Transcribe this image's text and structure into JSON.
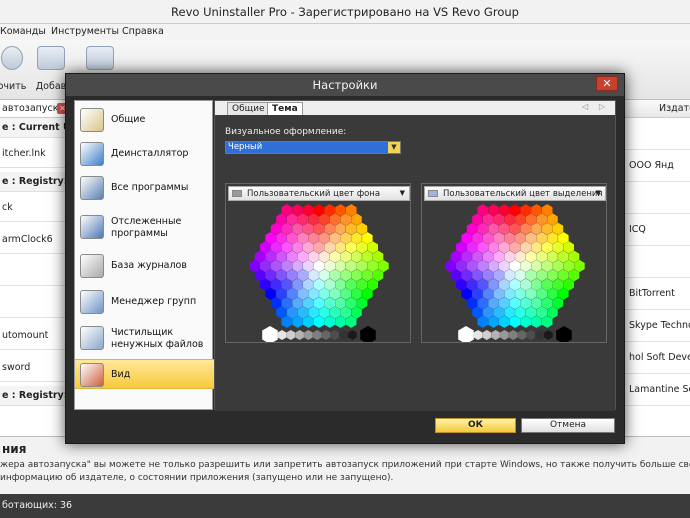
{
  "app": {
    "title": "Revo Uninstaller Pro - Зарегистрировано на VS Revo Group",
    "menu": [
      "Команды",
      "Инструменты",
      "Справка"
    ],
    "toolbar": [
      "очить",
      "Добав"
    ],
    "search_text": "автозапуска",
    "left_rows": [
      {
        "text": "e : Current User",
        "bold": true
      },
      {
        "text": "itcher.lnk",
        "bold": false
      },
      {
        "text": "e : Registry: HK",
        "bold": true
      },
      {
        "text": "ck",
        "bold": false
      },
      {
        "text": "armClock6",
        "bold": false
      },
      {
        "text": "",
        "bold": false
      },
      {
        "text": "",
        "bold": false
      },
      {
        "text": "utomount",
        "bold": false
      },
      {
        "text": "sword",
        "bold": false
      },
      {
        "text": "e : Registry: HK",
        "bold": true
      }
    ],
    "right_header": "Издате",
    "right_rows": [
      "",
      "ООО Янд",
      "",
      "ICQ",
      "",
      "BitTorrent",
      "Skype Technol",
      "hol Soft Develo",
      "Lamantine Sof",
      ""
    ],
    "info_title": "ния",
    "info_line1": "жера автозапуска\" вы можете не только разрешить или запретить автозапуск приложений при старте Windows, но также получить больше сведений о конкретном прило",
    "info_line2": "информацию об издателе, о состоянии приложения (запущено или не запущено).",
    "status": "ботающих: 36"
  },
  "dialog": {
    "title": "Настройки",
    "close_glyph": "✕",
    "nav": [
      {
        "label": "Общие",
        "icon": "clipboard-icon"
      },
      {
        "label": "Деинсталлятор",
        "icon": "uninstaller-icon"
      },
      {
        "label": "Все программы",
        "icon": "monitor-icon"
      },
      {
        "label": "Отслеженные программы",
        "icon": "user-monitor-icon"
      },
      {
        "label": "База журналов",
        "icon": "database-icon"
      },
      {
        "label": "Менеджер групп",
        "icon": "group-manager-icon"
      },
      {
        "label": "Чистильщик ненужных файлов",
        "icon": "cleaner-icon"
      },
      {
        "label": "Вид",
        "icon": "view-icon"
      }
    ],
    "active_nav": 7,
    "tabs": [
      "Общие",
      "Тема"
    ],
    "active_tab": 1,
    "tab_arrows": "◁ ▷",
    "visual_label": "Визуальное оформление:",
    "theme_value": "Черный",
    "picker_bg_label": "Пользовательский цвет фона",
    "picker_sel_label": "Пользовательский цвет выделения",
    "ok_label": "ОК",
    "cancel_label": "Отмена"
  },
  "colors": {
    "dialog_bg": "#2b2b2b",
    "content_bg": "#3a3a3a",
    "accent_yellow": "#f7c93c",
    "select_blue": "#2f6fd6",
    "close_red": "#c7412f"
  }
}
